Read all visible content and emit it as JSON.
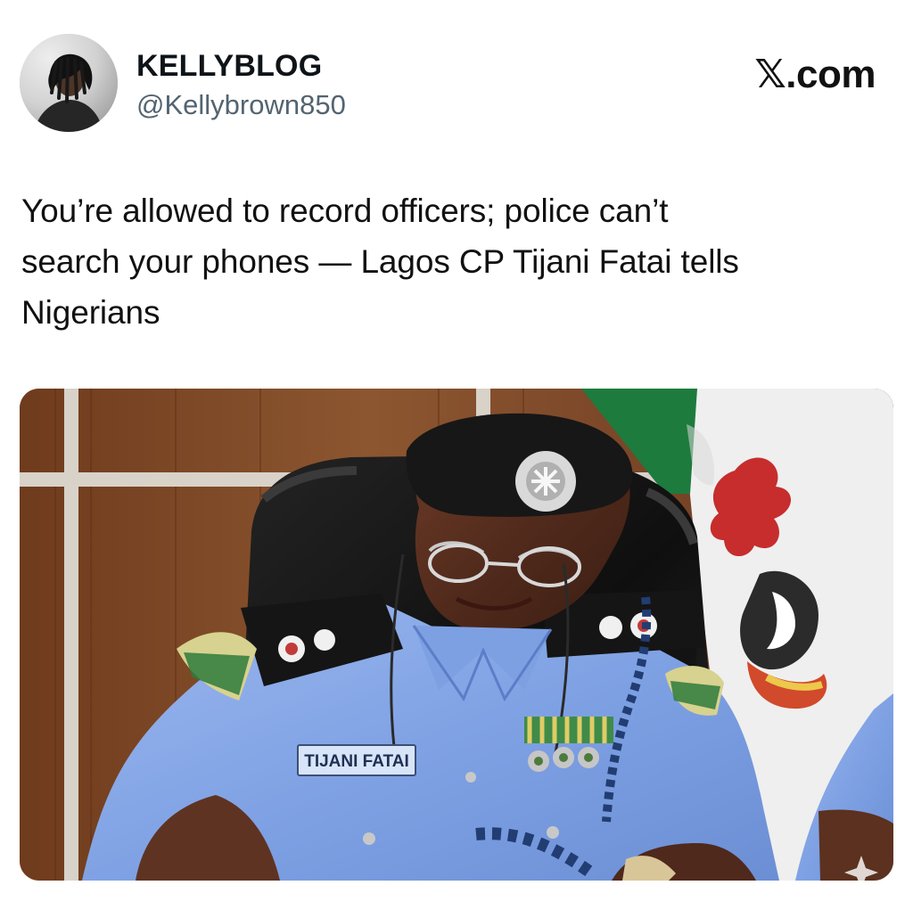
{
  "author": {
    "display_name": "KELLYBLOG",
    "handle": "@Kellybrown850",
    "avatar_icon": "avatar-image"
  },
  "platform": {
    "label": "𝕏.com"
  },
  "post": {
    "text": "You’re allowed to record officers; police can’t\nsearch your phones — Lagos CP Tijani Fatai tells\nNigerians"
  },
  "image": {
    "name_tag_text": "TIJANI FATAI",
    "watermark_icon": "sparkle-icon"
  },
  "colors": {
    "uniform_blue": "#86a7e5",
    "beret_black": "#171717",
    "wood_brown": "#7a4526",
    "flag_green": "#1d7b3d",
    "flag_white": "#f4f4f4"
  }
}
